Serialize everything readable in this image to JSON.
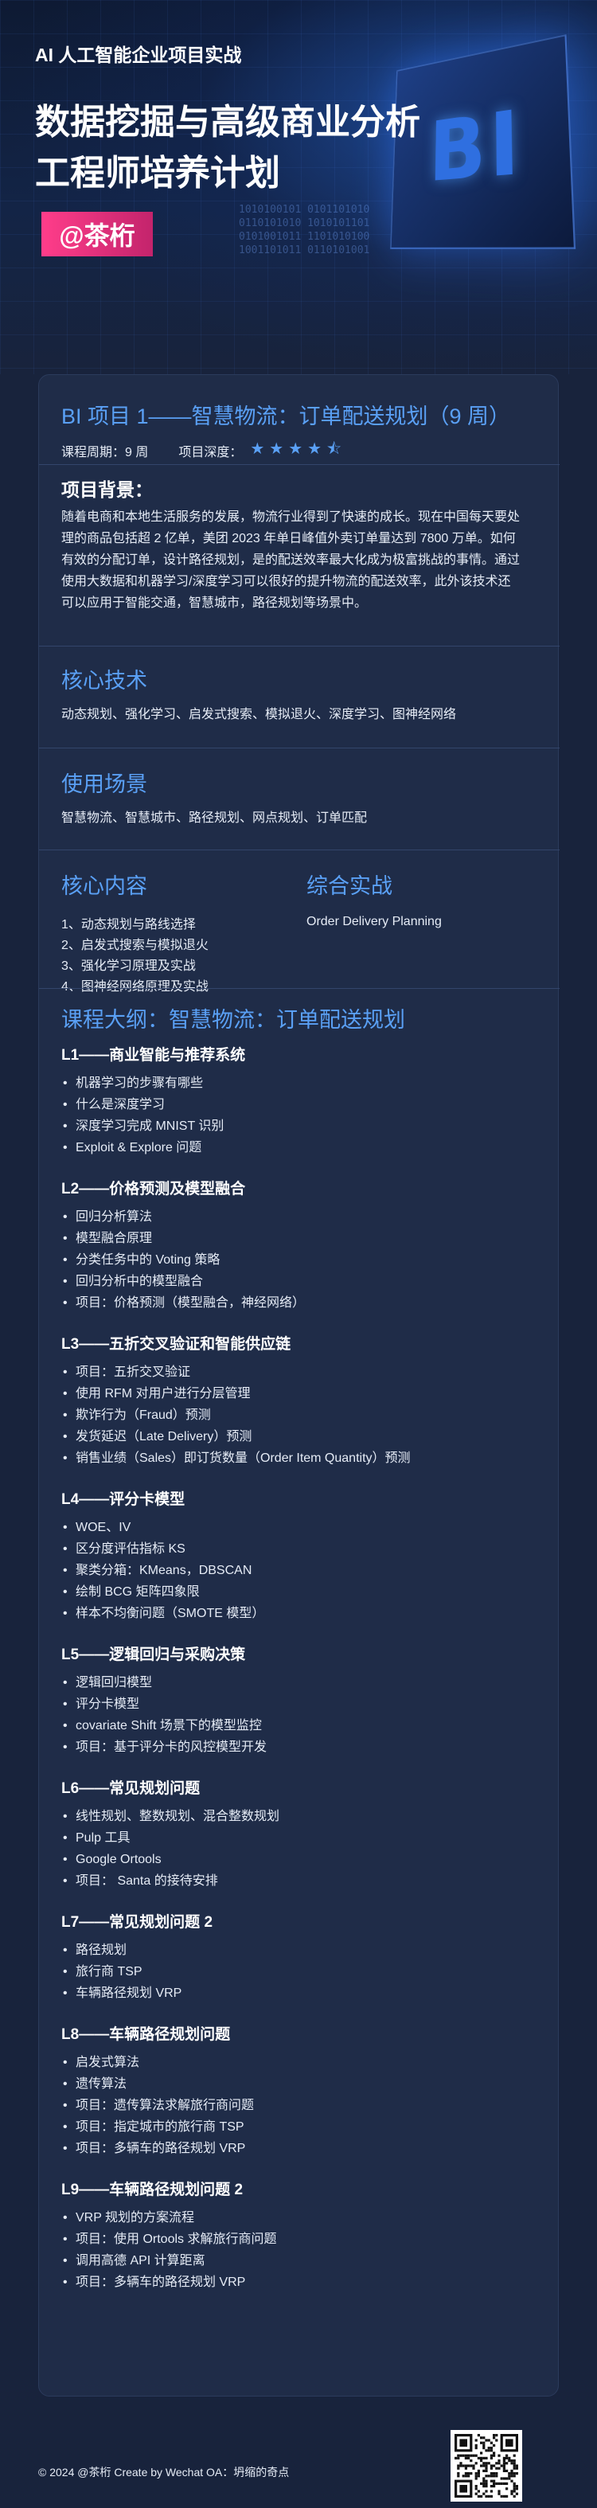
{
  "hero": {
    "subtitle": "AI 人工智能企业项目实战",
    "title_line1": "数据挖掘与高级商业分析",
    "title_line2": "工程师培养计划",
    "author": "@茶桁",
    "cube_text": "BI",
    "binary": "1010100101 0101101010 0110101010 1010101101 0101001011 1101010100 1001101011 0110101001"
  },
  "project": {
    "title": "BI 项目 1——智慧物流：订单配送规划（9 周）",
    "period": "课程周期：9 周",
    "difficulty_label": "项目深度：",
    "stars": "★★★★⯪"
  },
  "background": {
    "heading": "项目背景：",
    "text": "随着电商和本地生活服务的发展，物流行业得到了快速的成长。现在中国每天要处理的商品包括超 2 亿单，美团 2023 年单日峰值外卖订单量达到 7800 万单。如何有效的分配订单，设计路径规划，是的配送效率最大化成为极富挑战的事情。通过使用大数据和机器学习/深度学习可以很好的提升物流的配送效率，此外该技术还可以应用于智能交通，智慧城市，路径规划等场景中。"
  },
  "tech": {
    "heading": "核心技术",
    "text": "动态规划、强化学习、启发式搜索、模拟退火、深度学习、图神经网络"
  },
  "usage": {
    "heading": "使用场景",
    "text": "智慧物流、智慧城市、路径规划、网点规划、订单匹配"
  },
  "content": {
    "heading": "核心内容",
    "items": [
      "1、动态规划与路线选择",
      "2、启发式搜索与模拟退火",
      "3、强化学习原理及实战",
      "4、图神经网络原理及实战"
    ]
  },
  "practice": {
    "heading": "综合实战",
    "text": "Order Delivery Planning"
  },
  "outline": {
    "title": "课程大纲：智慧物流：订单配送规划",
    "lessons": [
      {
        "title": "L1——商业智能与推荐系统",
        "items": [
          "机器学习的步骤有哪些",
          "什么是深度学习",
          "深度学习完成 MNIST 识别",
          "Exploit & Explore 问题"
        ]
      },
      {
        "title": "L2——价格预测及模型融合",
        "items": [
          "回归分析算法",
          "模型融合原理",
          "分类任务中的 Voting 策略",
          "回归分析中的模型融合",
          "项目：价格预测（模型融合，神经网络）"
        ]
      },
      {
        "title": "L3——五折交叉验证和智能供应链",
        "items": [
          "项目：五折交叉验证",
          "使用 RFM 对用户进行分层管理",
          "欺诈行为（Fraud）预测",
          "发货延迟（Late Delivery）预测",
          "销售业绩（Sales）即订货数量（Order Item Quantity）预测"
        ]
      },
      {
        "title": "L4——评分卡模型",
        "items": [
          "WOE、IV",
          "区分度评估指标 KS",
          "聚类分箱：KMeans，DBSCAN",
          "绘制 BCG 矩阵四象限",
          "样本不均衡问题（SMOTE 模型）"
        ]
      },
      {
        "title": "L5——逻辑回归与采购决策",
        "items": [
          "逻辑回归模型",
          "评分卡模型",
          "covariate Shift 场景下的模型监控",
          "项目：基于评分卡的风控模型开发"
        ]
      },
      {
        "title": "L6——常见规划问题",
        "items": [
          "线性规划、整数规划、混合整数规划",
          "Pulp 工具",
          "Google Ortools",
          "项目： Santa 的接待安排"
        ]
      },
      {
        "title": "L7——常见规划问题 2",
        "items": [
          "路径规划",
          "旅行商 TSP",
          "车辆路径规划 VRP"
        ]
      },
      {
        "title": "L8——车辆路径规划问题",
        "items": [
          "启发式算法",
          "遗传算法",
          "项目：遗传算法求解旅行商问题",
          "项目：指定城市的旅行商 TSP",
          "项目：多辆车的路径规划 VRP"
        ]
      },
      {
        "title": "L9——车辆路径规划问题 2",
        "items": [
          "VRP 规划的方案流程",
          "项目：使用 Ortools 求解旅行商问题",
          "调用高德 API 计算距离",
          "项目：多辆车的路径规划 VRP"
        ]
      }
    ]
  },
  "footer": {
    "text": "© 2024 @茶桁 Create by Wechat OA：坍缩的奇点"
  }
}
